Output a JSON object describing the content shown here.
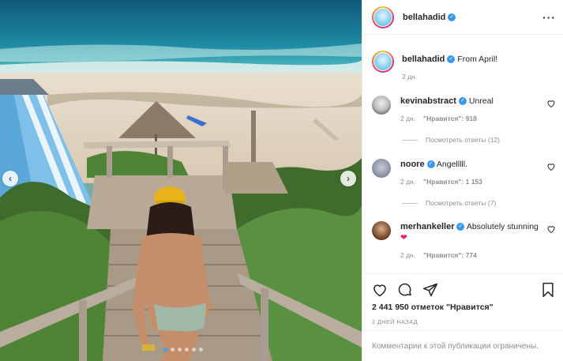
{
  "post": {
    "author": "bellahadid",
    "caption": {
      "username": "bellahadid",
      "text": "From April!",
      "time": "2 дн."
    },
    "comments": [
      {
        "username": "kevinabstract",
        "text": "Unreal",
        "time": "2 дн.",
        "likes": "\"Нравится\": 918",
        "replies": "Посмотреть ответы (12)"
      },
      {
        "username": "noore",
        "text": "Angelllll.",
        "time": "2 дн.",
        "likes": "\"Нравится\": 1 153",
        "replies": "Посмотреть ответы (7)"
      },
      {
        "username": "merhankeller",
        "text": "Absolutely stunning",
        "time": "2 дн.",
        "likes": "\"Нравится\": 774"
      }
    ],
    "likes_count": "2 441 950 отметок \"Нравится\"",
    "posted": "2 ДНЕЙ НАЗАД",
    "comments_limited": "Комментарии к этой публикации ограничены.",
    "carousel": {
      "total": 6,
      "active": 1
    }
  },
  "icons": {
    "more": "more-icon",
    "heart": "heart-icon",
    "comment": "comment-icon",
    "share": "share-icon",
    "bookmark": "bookmark-icon",
    "verified": "verified-icon",
    "prev": "chevron-left-icon",
    "next": "chevron-right-icon"
  },
  "colors": {
    "verified": "#3897f0",
    "active_dot": "#3aa0f5",
    "heart_emoji": "#e0245e"
  }
}
